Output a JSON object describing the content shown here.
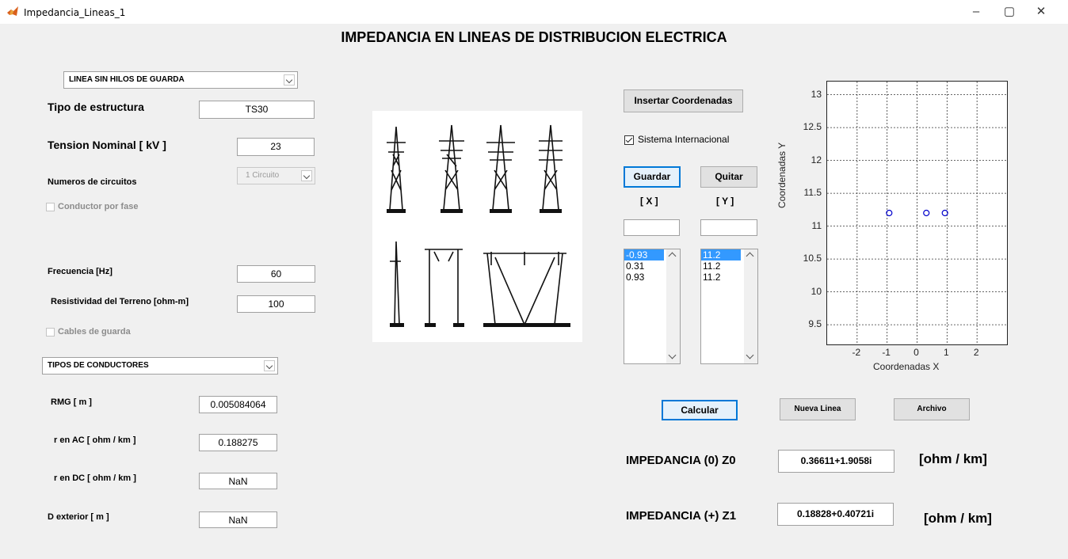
{
  "window": {
    "title": "Impedancia_Lineas_1",
    "controls": [
      "–",
      "▢",
      "✕"
    ]
  },
  "main_title": "IMPEDANCIA EN LINEAS DE DISTRIBUCION ELECTRICA",
  "left": {
    "line_type_select": "LINEA SIN HILOS DE GUARDA",
    "tipo_estructura_label": "Tipo de estructura",
    "tipo_estructura_value": "TS30",
    "tension_label": "Tension Nominal    [ kV ]",
    "tension_value": "23",
    "circuitos_label": "Numeros de circuitos",
    "circuitos_select": "1 Circuito",
    "conductor_fase_label": "Conductor por fase",
    "frecuencia_label": "Frecuencia [Hz]",
    "frecuencia_value": "60",
    "resistividad_label": "Resistividad del Terreno [ohm-m]",
    "resistividad_value": "100",
    "cables_guarda_label": "Cables de guarda",
    "conductores_select": "TIPOS DE CONDUCTORES",
    "rmg_label": "RMG   [ m ]",
    "rmg_value": "0.005084064",
    "rac_label": "r en AC  [ ohm / km ]",
    "rac_value": "0.188275",
    "rdc_label": "r en DC  [ ohm / km ]",
    "rdc_value": "NaN",
    "dext_label": "D exterior   [ m ]",
    "dext_value": "NaN"
  },
  "middle": {
    "insertar_button": "Insertar Coordenadas",
    "sistema_label": "Sistema Internacional",
    "sistema_checked": true,
    "guardar_button": "Guardar",
    "quitar_button": "Quitar",
    "x_header": "[ X ]",
    "y_header": "[ Y ]",
    "x_input": "",
    "y_input": "",
    "x_list": [
      "-0.93",
      "0.31",
      "0.93"
    ],
    "y_list": [
      "11.2",
      "11.2",
      "11.2"
    ],
    "calcular_button": "Calcular",
    "nueva_linea_button": "Nueva Linea",
    "archivo_button": "Archivo",
    "z0_label": "IMPEDANCIA  (0)  Z0",
    "z0_value": "0.36611+1.9058i",
    "z0_unit": "[ohm / km]",
    "z1_label": "IMPEDANCIA  (+)  Z1",
    "z1_value": "0.18828+0.40721i",
    "z1_unit": "[ohm / km]"
  },
  "chart_data": {
    "type": "scatter",
    "x": [
      -0.93,
      0.31,
      0.93
    ],
    "y": [
      11.2,
      11.2,
      11.2
    ],
    "xlabel": "Coordenadas  X",
    "ylabel": "Coordenadas  Y",
    "xlim": [
      -3,
      3
    ],
    "ylim": [
      9.2,
      13.2
    ],
    "xticks": [
      "-2",
      "-1",
      "0",
      "1",
      "2"
    ],
    "yticks": [
      "9.5",
      "10",
      "10.5",
      "11",
      "11.5",
      "12",
      "12.5",
      "13"
    ],
    "grid": true,
    "marker_color": "#0000cc"
  },
  "colors": {
    "background": "#f0f0f0",
    "selection": "#3399ff",
    "default_button_border": "#0078d7"
  }
}
